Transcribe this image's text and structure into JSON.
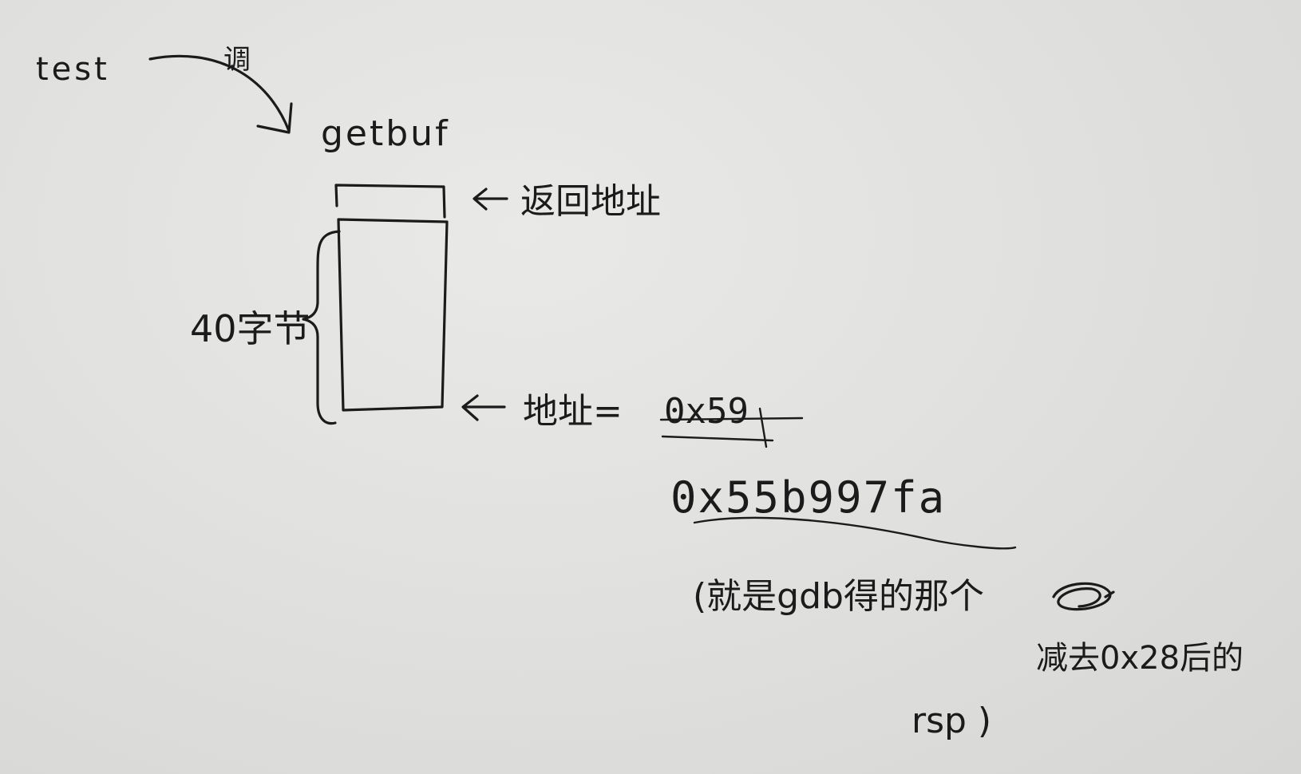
{
  "nodes": {
    "caller": "test",
    "call_label": "调",
    "callee": "getbuf"
  },
  "stack": {
    "return_address_label": "返回地址",
    "size_label": "40字节",
    "address_label": "地址=",
    "struck_value": "0x59",
    "address_value": "0x55b997fa"
  },
  "note": {
    "line1": "(就是gdb得的那个",
    "line2": "减去0x28后的",
    "line3": "rsp )"
  },
  "colors": {
    "ink": "#1b1b1b",
    "paper": "#e3e3e1"
  }
}
